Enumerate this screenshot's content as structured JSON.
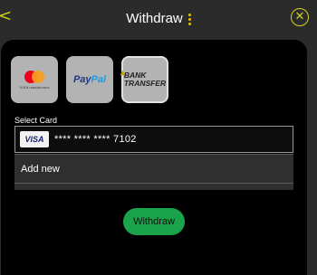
{
  "header": {
    "title": "Withdraw",
    "back_icon": "chevron-left-icon",
    "menu_icon": "kebab-menu-icon",
    "close_icon": "close-icon",
    "accent_color": "#d7d21d"
  },
  "payment_methods": [
    {
      "name": "Mastercard / Visa",
      "caption": "VISA  mastercard"
    },
    {
      "name": "PayPal",
      "text_a": "Pay",
      "text_b": "Pal"
    },
    {
      "name": "Bank Transfer",
      "line1": "BANK",
      "line2": "TRANSFER"
    }
  ],
  "select_card": {
    "label": "Select Card",
    "card_brand": "VISA",
    "card_number": "**** **** **** 7102",
    "add_new": "Add new"
  },
  "actions": {
    "withdraw_label": "Withdraw",
    "withdraw_color": "#1aa34a"
  }
}
